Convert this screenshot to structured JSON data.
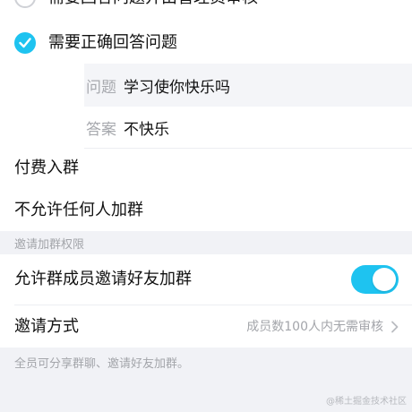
{
  "join_options": {
    "answer_and_admin_review": "需要回答问题并由管理员审核",
    "correct_answer_required": "需要正确回答问题"
  },
  "question": {
    "key": "问题",
    "value": "学习使你快乐吗"
  },
  "answer": {
    "key": "答案",
    "value": "不快乐"
  },
  "paid_join": "付费入群",
  "no_one_can_join": "不允许任何人加群",
  "invite_section": {
    "title": "邀请加群权限",
    "allow_member_invite": "允许群成员邀请好友加群",
    "allow_member_invite_enabled": true,
    "invite_method_label": "邀请方式",
    "invite_method_value": "成员数100人内无需审核",
    "footer_note": "全员可分享群聊、邀请好友加群。"
  },
  "watermark": "@稀土掘金技术社区",
  "colors": {
    "accent": "#1ec3f0",
    "background": "#f1f2f6"
  }
}
